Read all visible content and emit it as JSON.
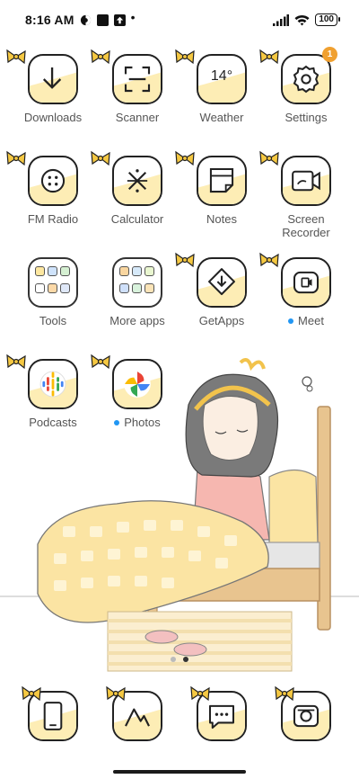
{
  "status_bar": {
    "time": "8:16 AM",
    "icons": [
      "vpn-icon",
      "notification-square-icon",
      "upload-icon",
      "more-dot-icon"
    ],
    "signal": "signal-icon",
    "wifi": "wifi-icon",
    "battery": "100"
  },
  "apps": [
    {
      "label": "Downloads",
      "icon": "download-icon"
    },
    {
      "label": "Scanner",
      "icon": "scanner-icon"
    },
    {
      "label": "Weather",
      "icon": "weather-icon",
      "temp": "14°"
    },
    {
      "label": "Settings",
      "icon": "gear-icon",
      "badge": "1"
    },
    {
      "label": "FM Radio",
      "icon": "radio-icon"
    },
    {
      "label": "Calculator",
      "icon": "calculator-icon"
    },
    {
      "label": "Notes",
      "icon": "notes-icon"
    },
    {
      "label": "Screen\nRecorder",
      "icon": "screen-recorder-icon"
    },
    {
      "label": "Tools",
      "icon": "folder-icon"
    },
    {
      "label": "More apps",
      "icon": "folder-icon"
    },
    {
      "label": "GetApps",
      "icon": "getapps-icon"
    },
    {
      "label": "Meet",
      "icon": "meet-icon",
      "new": true
    },
    {
      "label": "Podcasts",
      "icon": "podcasts-icon"
    },
    {
      "label": "Photos",
      "icon": "photos-icon",
      "new": true
    }
  ],
  "dock": [
    {
      "icon": "phone-icon"
    },
    {
      "icon": "gallery-icon"
    },
    {
      "icon": "messages-icon"
    },
    {
      "icon": "camera-icon"
    }
  ],
  "page_indicator": {
    "pages": 2,
    "current": 2
  },
  "colors": {
    "cream": "#fdedb5",
    "outline": "#222222",
    "bow": "#f5c842",
    "badge": "#f0a030",
    "new_dot": "#2196f3"
  }
}
